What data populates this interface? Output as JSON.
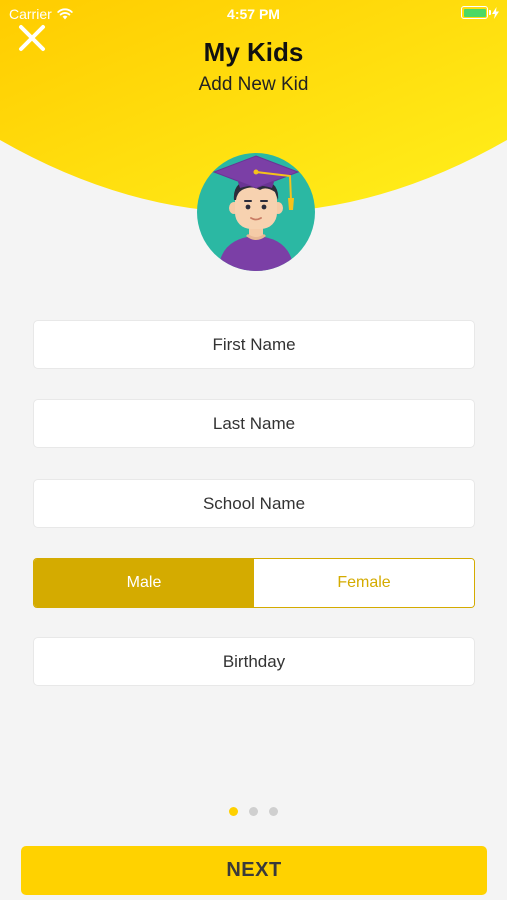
{
  "status_bar": {
    "carrier": "Carrier",
    "time": "4:57 PM",
    "battery_color": "#4cd964"
  },
  "header": {
    "title": "My Kids",
    "subtitle": "Add New Kid",
    "close_icon": "close-icon",
    "gradient_start": "#ffcc00",
    "gradient_end": "#fff01c"
  },
  "avatar": {
    "icon": "kid-graduate-avatar"
  },
  "form": {
    "first_name": {
      "placeholder": "First Name",
      "value": ""
    },
    "last_name": {
      "placeholder": "Last Name",
      "value": ""
    },
    "school_name": {
      "placeholder": "School Name",
      "value": ""
    },
    "gender": {
      "options": [
        "Male",
        "Female"
      ],
      "selected": "Male"
    },
    "birthday": {
      "placeholder": "Birthday",
      "value": ""
    }
  },
  "pagination": {
    "total": 3,
    "current": 1
  },
  "next_button": {
    "label": "NEXT",
    "color": "#ffd200"
  },
  "accent_color": "#d4ab00"
}
